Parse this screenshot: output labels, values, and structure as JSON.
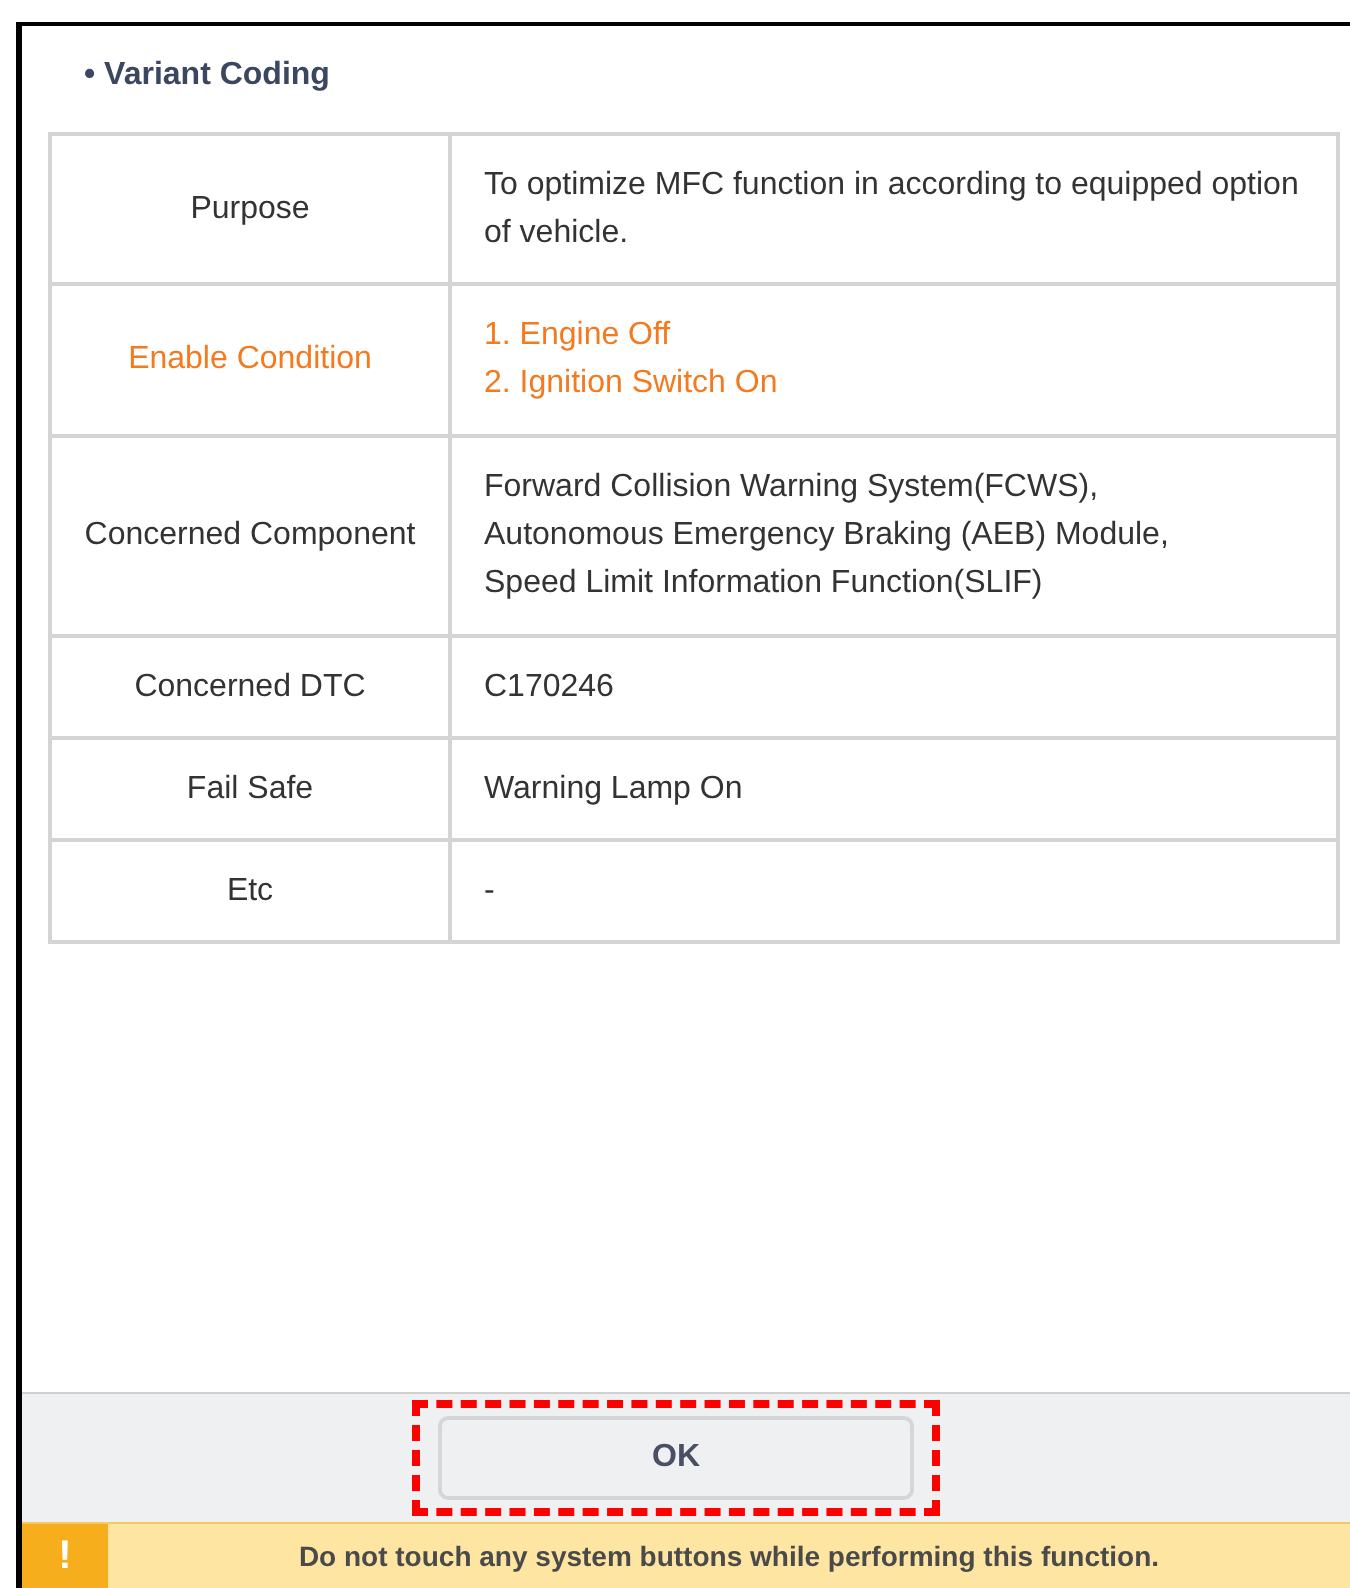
{
  "section_title": "• Variant Coding",
  "table": {
    "rows": [
      {
        "label": "Purpose",
        "emphasis": false,
        "lines": [
          "To optimize MFC function in according to equipped option of vehicle."
        ]
      },
      {
        "label": "Enable Condition",
        "emphasis": true,
        "lines": [
          "1. Engine Off",
          "2. Ignition Switch On"
        ]
      },
      {
        "label": "Concerned Component",
        "emphasis": false,
        "lines": [
          "Forward Collision Warning System(FCWS),",
          "Autonomous Emergency Braking (AEB) Module,",
          "Speed Limit Information Function(SLIF)"
        ]
      },
      {
        "label": "Concerned DTC",
        "emphasis": false,
        "lines": [
          "C170246"
        ]
      },
      {
        "label": "Fail Safe",
        "emphasis": false,
        "lines": [
          "Warning Lamp On"
        ]
      },
      {
        "label": "Etc",
        "emphasis": false,
        "lines": [
          "-"
        ]
      }
    ]
  },
  "ok_button": {
    "label": "OK",
    "highlighted": true
  },
  "warning": {
    "icon": "!",
    "text": "Do not touch any system buttons while performing this function."
  }
}
